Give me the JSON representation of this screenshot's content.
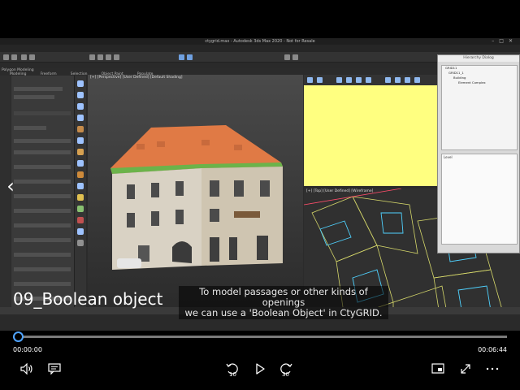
{
  "app": {
    "window_title": "ctygrid.max - Autodesk 3ds Max 2020 - Not for Resale"
  },
  "max_ui": {
    "menu": [
      "File",
      "Edit",
      "Tools",
      "Group",
      "Views",
      "Create",
      "Modifiers",
      "Animation",
      "Graph Editors",
      "Rendering",
      "Civil View",
      "Customize",
      "Scripting",
      "Interactive",
      "Content",
      "Arnold",
      "CtyGRID Modeler",
      "Help"
    ],
    "ribbon_tabs": [
      "Modeling",
      "Freeform",
      "Selection",
      "Object Paint",
      "Populate"
    ],
    "mode_label": "Polygon Modeling",
    "viewport_label": "[+] [Perspective] [User Defined] [Default Shading]",
    "map_viewport_label": "[+] [Top] [User Defined] [Wireframe]",
    "hierarchy_dialog": {
      "title": "Hierarchy Dialog",
      "tree": [
        "GRID11",
        "GRID11_1",
        "Building",
        "Element Complex"
      ],
      "list_title": "Level"
    }
  },
  "player": {
    "chapter_title": "09_Boolean object",
    "subtitle_line1": "To model passages or other kinds of openings",
    "subtitle_line2": "we can use a 'Boolean Object' in CtyGRID.",
    "time_current": "00:00:00",
    "time_total": "00:06:44",
    "progress": 0.0,
    "rewind_seconds": "10",
    "forward_seconds": "30",
    "accent_color": "#4fa3ff"
  }
}
